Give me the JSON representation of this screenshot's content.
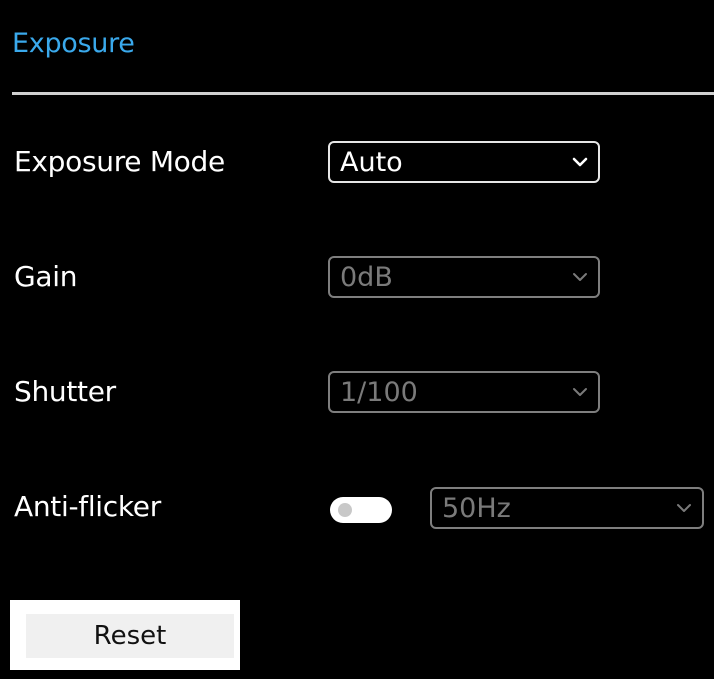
{
  "panel": {
    "title": "Exposure",
    "title_color": "#3aa9ec"
  },
  "exposure_mode": {
    "label": "Exposure Mode",
    "value": "Auto",
    "enabled": true
  },
  "gain": {
    "label": "Gain",
    "value": "0dB",
    "enabled": false
  },
  "shutter": {
    "label": "Shutter",
    "value": "1/100",
    "enabled": false
  },
  "anti_flicker": {
    "label": "Anti-flicker",
    "toggle_on": false,
    "value": "50Hz",
    "enabled": false
  },
  "reset": {
    "label": "Reset"
  },
  "icons": {
    "dropdown": "chevron-down-icon"
  }
}
